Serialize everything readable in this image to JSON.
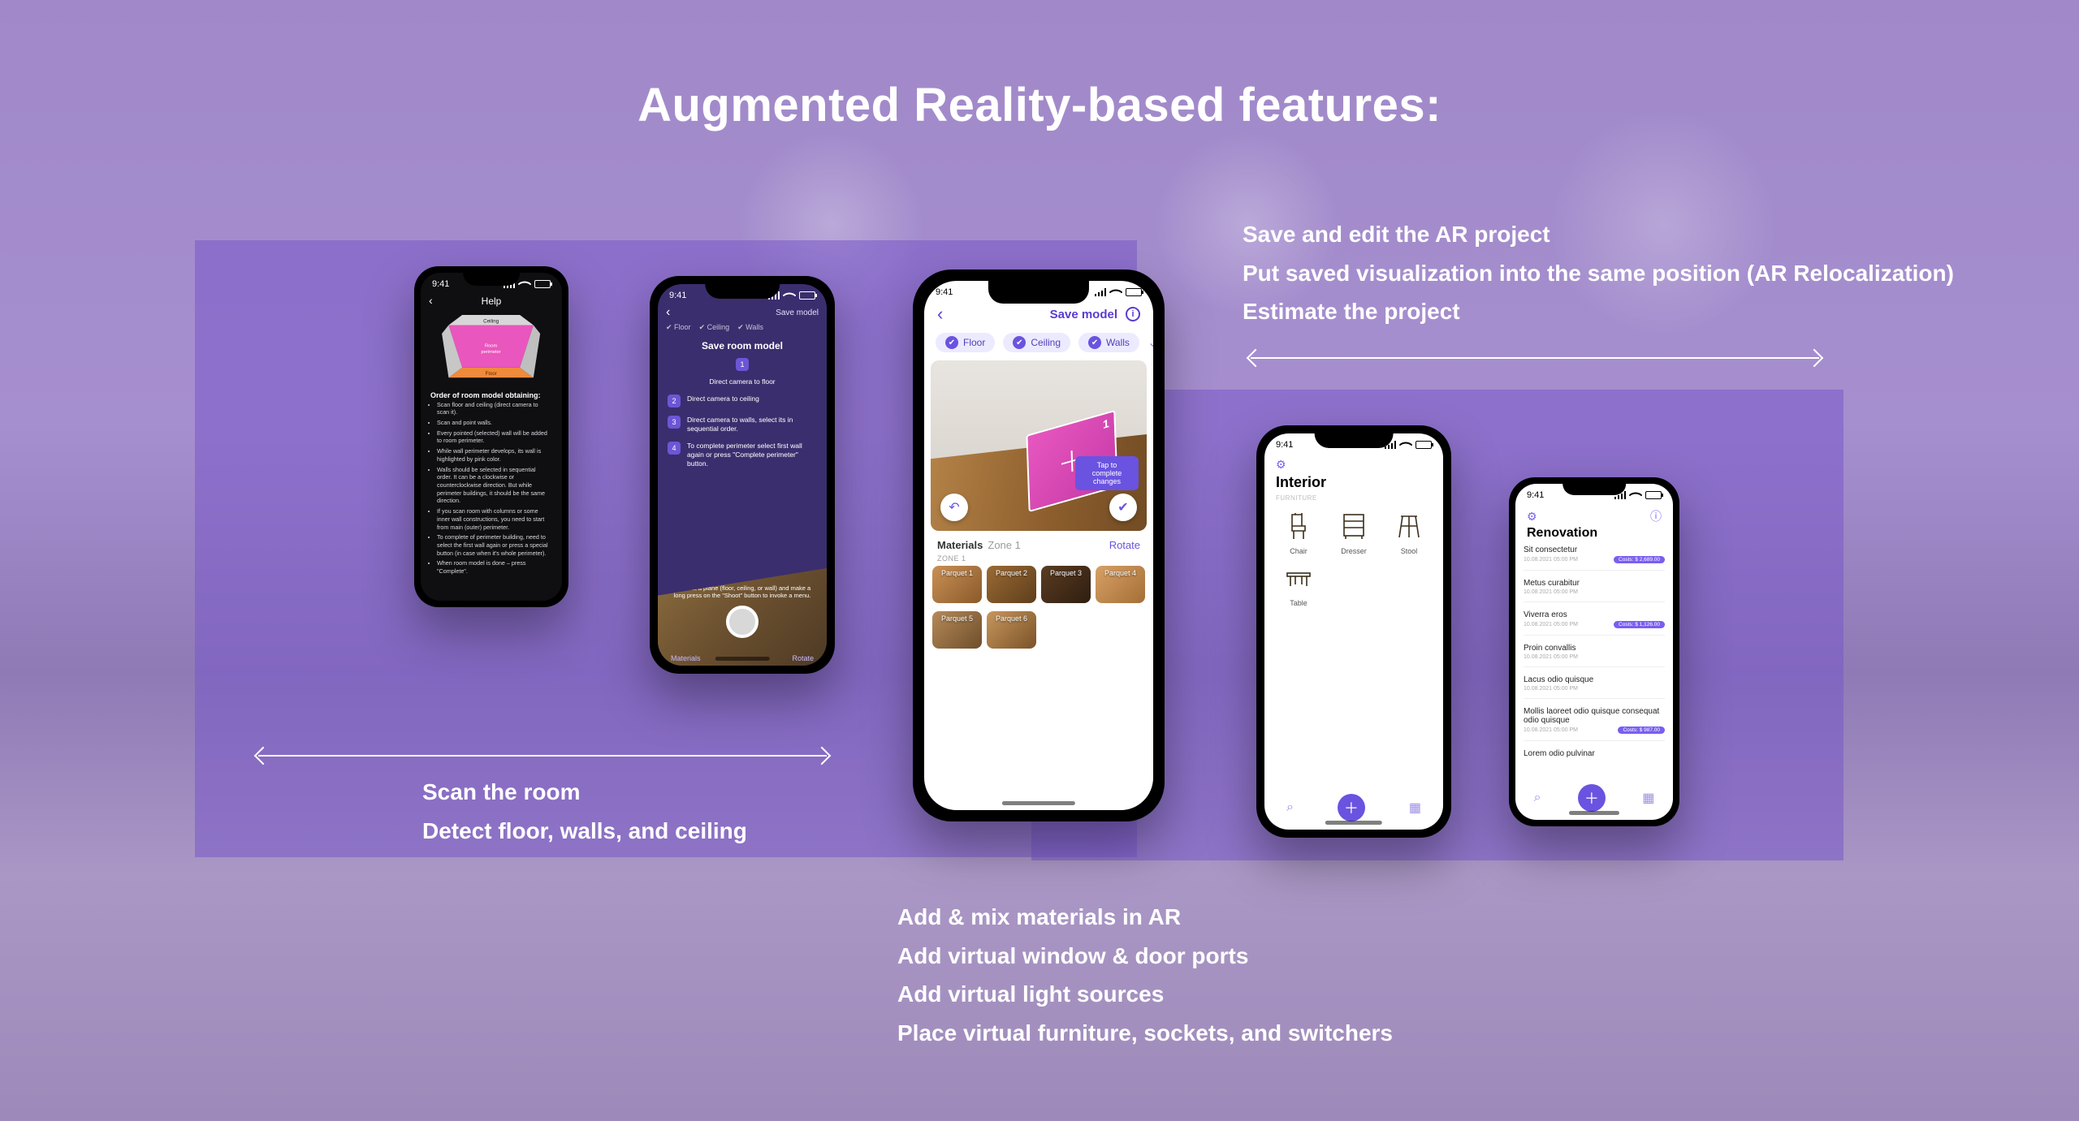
{
  "heading": "Augmented Reality-based features:",
  "status_time": "9:41",
  "features_top_right": [
    "Save and edit the AR project",
    "Put saved visualization into the same position (AR Relocalization)",
    "Estimate the project"
  ],
  "features_bottom_left": [
    "Scan the room",
    "Detect floor, walls, and ceiling"
  ],
  "features_bottom_center": [
    "Add & mix materials in AR",
    "Add virtual window & door ports",
    "Add virtual light sources",
    "Place virtual furniture, sockets, and switchers"
  ],
  "phone1": {
    "title": "Help",
    "room_labels": {
      "ceiling": "Ceiling",
      "perimeter": "Room perimeter",
      "floor": "Floor"
    },
    "subhead": "Order of room model obtaining:",
    "bullets": [
      "Scan floor and ceiling (direct camera to scan it).",
      "Scan and point walls.",
      "Every pointed (selected) wall will be added to room perimeter.",
      "While wall perimeter develops, its wall is highlighted by pink color.",
      "Walls should be selected in sequential order. It can be a clockwise or counterclockwise direction. But while perimeter buildings, it should be the same direction.",
      "If you scan room with columns or some inner wall constructions, you need to start from main (outer) perimeter.",
      "To complete of perimeter building, need to select the first wall again or press a special button (in case when it's whole perimeter).",
      "When room model is done – press \"Complete\"."
    ]
  },
  "phone2": {
    "save_link": "Save model",
    "tabs": [
      "Floor",
      "Ceiling",
      "Walls"
    ],
    "title": "Save room model",
    "steps": [
      "Direct camera to floor",
      "Direct camera to ceiling",
      "Direct camera to walls, select its in sequential order.",
      "To complete perimeter select first wall again or press \"Complete perimeter\" button."
    ],
    "bottom_hint": "Direct at a plane (floor, ceiling, or wall) and make a long press on the \"Shoot\" button to invoke a menu.",
    "footer": {
      "left": "Materials",
      "right": "Rotate"
    }
  },
  "phone3": {
    "save_link": "Save model",
    "tabs": [
      "Floor",
      "Ceiling",
      "Walls"
    ],
    "tip": "Tap to complete changes",
    "corner": "1",
    "materials_label": "Materials",
    "zone_label": "Zone 1",
    "rotate_label": "Rotate",
    "zone_header": "ZONE 1",
    "tiles_row1": [
      "Parquet 1",
      "Parquet 2",
      "Parquet 3",
      "Parquet 4"
    ],
    "tiles_row2": [
      "Parquet 5",
      "Parquet 6"
    ]
  },
  "phone4": {
    "title": "Interior",
    "subhead": "FURNITURE",
    "items": [
      {
        "label": "Chair"
      },
      {
        "label": "Dresser"
      },
      {
        "label": "Stool"
      },
      {
        "label": "Table"
      }
    ]
  },
  "phone5": {
    "title": "Renovation",
    "rows": [
      {
        "t": "Sit consectetur",
        "d": "10.08.2021 05:00 PM",
        "badge": "Costs: $ 2,689.00"
      },
      {
        "t": "Metus curabitur",
        "d": "10.08.2021 05:00 PM"
      },
      {
        "t": "Viverra eros",
        "d": "10.08.2021 05:00 PM",
        "badge": "Costs: $ 1,126.00"
      },
      {
        "t": "Proin convallis",
        "d": "10.08.2021 05:00 PM"
      },
      {
        "t": "Lacus odio quisque",
        "d": "10.08.2021 05:00 PM"
      },
      {
        "t": "Mollis laoreet odio quisque consequat odio quisque",
        "d": "10.08.2021 05:00 PM",
        "badge": "Costs: $ 987.00"
      },
      {
        "t": "Lorem odio pulvinar",
        "d": ""
      }
    ]
  }
}
